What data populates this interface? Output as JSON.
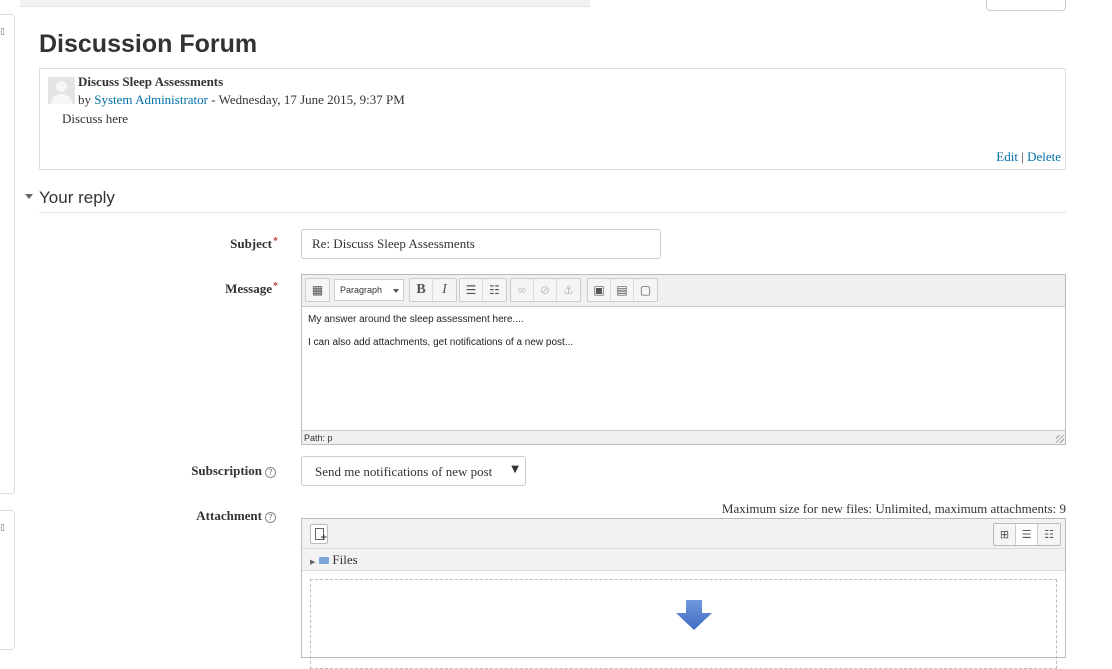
{
  "page": {
    "title": "Discussion Forum"
  },
  "post": {
    "subject": "Discuss Sleep Assessments",
    "by_prefix": "by",
    "author": "System Administrator",
    "date": "- Wednesday, 17 June 2015, 9:37 PM",
    "body": "Discuss here",
    "commands": {
      "edit": "Edit",
      "separator": "|",
      "delete": "Delete"
    }
  },
  "reply": {
    "legend": "Your reply",
    "subject": {
      "label": "Subject",
      "value": "Re: Discuss Sleep Assessments"
    },
    "message": {
      "label": "Message",
      "format": "Paragraph",
      "lines": [
        "My answer around the sleep assessment here....",
        "I can also add attachments, get notifications of a new post..."
      ],
      "path": "Path: p"
    },
    "subscription": {
      "label": "Subscription",
      "selected": "Send me notifications of new post"
    },
    "attachment": {
      "label": "Attachment",
      "max_info": "Maximum size for new files: Unlimited, maximum attachments: 9",
      "folder": "Files"
    }
  },
  "colors": {
    "link": "#0070a8",
    "required": "#b94a48",
    "drop_arrow": "#4a78c8"
  }
}
